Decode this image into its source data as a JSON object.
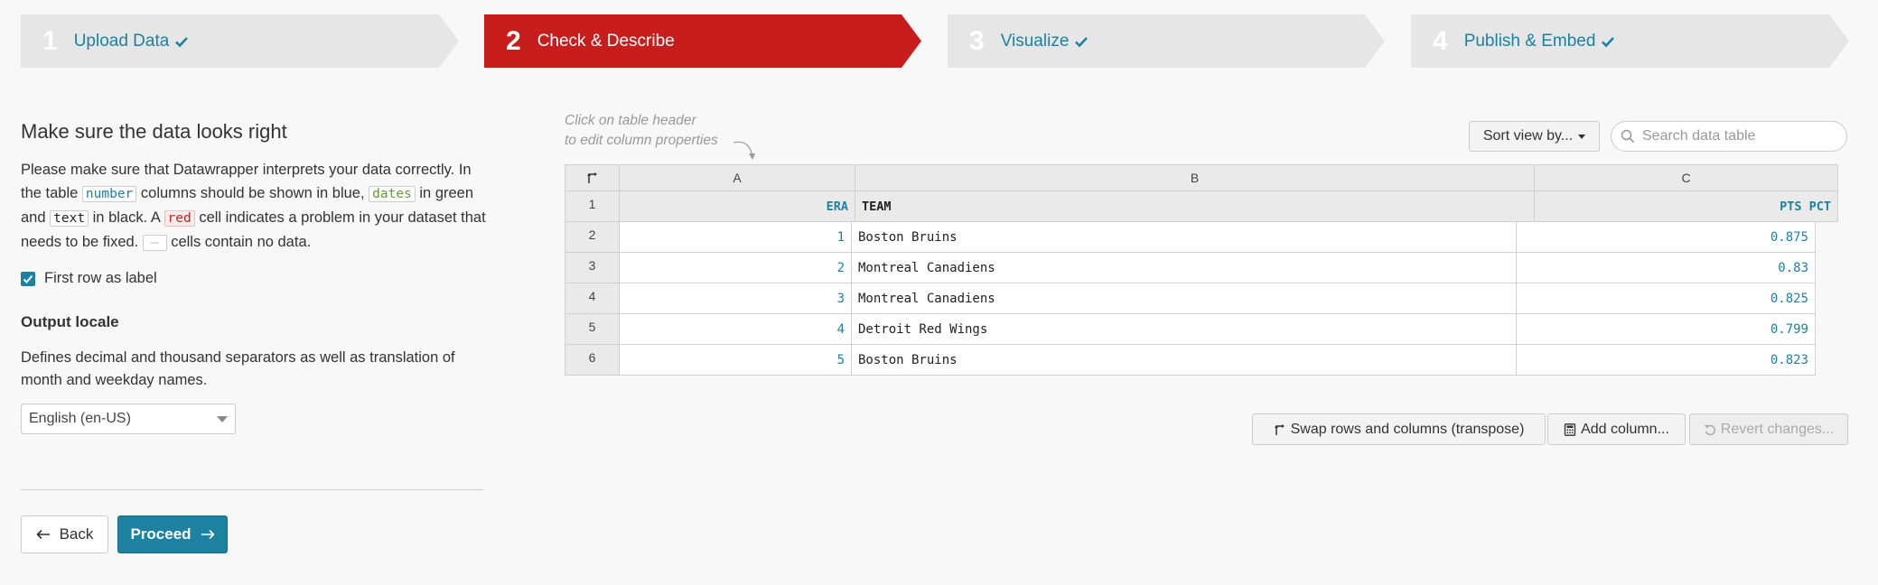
{
  "steps": [
    {
      "num": "1",
      "label": "Upload Data",
      "checked": true
    },
    {
      "num": "2",
      "label": "Check & Describe",
      "checked": false
    },
    {
      "num": "3",
      "label": "Visualize",
      "checked": true
    },
    {
      "num": "4",
      "label": "Publish & Embed",
      "checked": true
    }
  ],
  "left": {
    "title": "Make sure the data looks right",
    "intro": {
      "p1": "Please make sure that Datawrapper interprets your data correctly. In the table",
      "kw_number": "number",
      "p2": "columns should be shown in blue,",
      "kw_dates": "dates",
      "p3": "in green and",
      "kw_text": "text",
      "p4": "in black. A",
      "kw_red": "red",
      "p5": "cell indicates a problem in your dataset that needs to be fixed.",
      "kw_empty": "–",
      "p6": "cells contain no data."
    },
    "first_row_label": "First row as label",
    "locale_title": "Output locale",
    "locale_desc": "Defines decimal and thousand separators as well as translation of month and weekday names.",
    "locale_value": "English (en-US)",
    "back_label": "Back",
    "proceed_label": "Proceed"
  },
  "hint": {
    "line1": "Click on table header",
    "line2": "to edit column properties"
  },
  "sort_label": "Sort view by...",
  "search_placeholder": "Search data table",
  "table": {
    "col_letters": [
      "A",
      "B",
      "C"
    ],
    "row_numbers": [
      "1",
      "2",
      "3",
      "4",
      "5",
      "6"
    ],
    "headers": [
      "ERA",
      "TEAM",
      "PTS PCT"
    ],
    "rows": [
      [
        "1",
        "Boston Bruins",
        "0.875"
      ],
      [
        "2",
        "Montreal Canadiens",
        "0.83"
      ],
      [
        "3",
        "Montreal Canadiens",
        "0.825"
      ],
      [
        "4",
        "Detroit Red Wings",
        "0.799"
      ],
      [
        "5",
        "Boston Bruins",
        "0.823"
      ]
    ]
  },
  "actions": {
    "transpose": "Swap rows and columns (transpose)",
    "add_column": "Add column...",
    "revert": "Revert changes..."
  },
  "colors": {
    "accent": "#1d81a2",
    "active_step": "#c71e1d",
    "date_green": "#5f9f3a"
  }
}
